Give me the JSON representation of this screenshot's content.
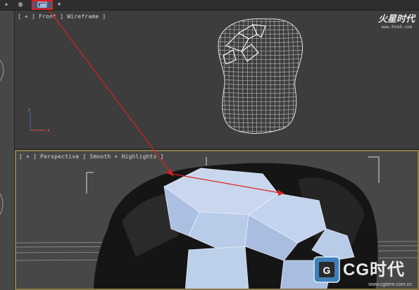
{
  "toolbar": {
    "icons": [
      "snap-icon",
      "render-icon",
      "viewport-layout-icon",
      "dropdown-arrow-icon"
    ]
  },
  "front_viewport": {
    "label": "[ + ] Front ] Wireframe ]",
    "view_name": "Front",
    "shading": "Wireframe"
  },
  "perspective_viewport": {
    "label": "[ + ] Perspective ] Smooth + Highlights ]",
    "view_name": "Perspective",
    "shading": "Smooth + Highlights"
  },
  "watermark": {
    "brand_top": "火星时代",
    "url_top": "www.hxsd.com",
    "brand_bottom": "CG时代",
    "url_bottom": "www.cgtime.com.cn"
  },
  "colors": {
    "annotation": "#e02020",
    "selection": "#ffffff",
    "mesh_face": "#b8cbe8",
    "active_border": "#8a7a4a"
  }
}
